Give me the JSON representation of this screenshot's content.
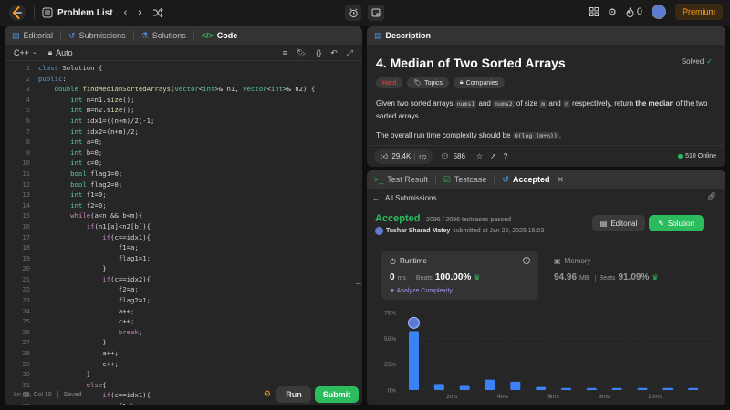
{
  "topbar": {
    "title": "Problem List",
    "premium": "Premium",
    "fire_count": "0"
  },
  "editor": {
    "tabs": [
      "Editorial",
      "Submissions",
      "Solutions",
      "Code"
    ],
    "language": "C++",
    "mode": "Auto",
    "status": "Ln 69, Col 10",
    "saved": "Saved",
    "run": "Run",
    "submit": "Submit"
  },
  "code_lines": [
    "class Solution {",
    "public:",
    "    double findMedianSortedArrays(vector<int>& n1, vector<int>& n2) {",
    "        int n=n1.size();",
    "        int m=n2.size();",
    "        int idx1=((n+m)/2)-1;",
    "        int idx2=(n+m)/2;",
    "        int a=0;",
    "        int b=0;",
    "        int c=0;",
    "        bool flag1=0;",
    "        bool flag2=0;",
    "        int f1=0;",
    "        int f2=0;",
    "        while(a<n && b<m){",
    "            if(n1[a]<n2[b]){",
    "                if(c==idx1){",
    "                    f1=a;",
    "                    flag1=1;",
    "                }",
    "                if(c==idx2){",
    "                    f2=a;",
    "                    flag2=1;",
    "                    a++;",
    "                    c++;",
    "                    break;",
    "                }",
    "                a++;",
    "                c++;",
    "            }",
    "            else{",
    "                if(c==idx1){",
    "                    f1=b;",
    "                }"
  ],
  "description": {
    "tab": "Description",
    "title": "4. Median of Two Sorted Arrays",
    "solved": "Solved",
    "chips": [
      "Hard",
      "Topics",
      "Companies"
    ],
    "para1_a": "Given two sorted arrays ",
    "code_nums1": "nums1",
    "para1_b": " and ",
    "code_nums2": "nums2",
    "para1_c": " of size ",
    "code_m": "m",
    "para1_d": " and ",
    "code_n": "n",
    "para1_e": " respectively, return ",
    "para1_bold": "the median",
    "para1_f": " of the two sorted arrays.",
    "para2": "The overall run time complexity should be ",
    "code_complexity": "O(log (m+n))",
    "para2_end": ".",
    "likes": "29.4K",
    "comments": "586",
    "online": "510 Online"
  },
  "result": {
    "tabs": [
      "Test Result",
      "Testcase",
      "Accepted"
    ],
    "back": "All Submissions",
    "status": "Accepted",
    "passed": "2096 / 2096 testcases passed",
    "user": "Tushar Sharad Matey",
    "submitted": "submitted at Jan 22, 2025 15:03",
    "editorial": "Editorial",
    "solution": "Solution",
    "runtime_label": "Runtime",
    "runtime_value": "0",
    "runtime_unit": "ms",
    "runtime_beats_label": "Beats",
    "runtime_beats": "100.00%",
    "analyze": "Analyze Complexity",
    "memory_label": "Memory",
    "memory_value": "94.96",
    "memory_unit": "MB",
    "memory_beats_label": "Beats",
    "memory_beats": "91.09%"
  },
  "chart_data": {
    "type": "bar",
    "y_ticks": [
      "75%",
      "50%",
      "25%",
      "0%"
    ],
    "ylim": [
      0,
      75
    ],
    "x_labels": [
      "2ms",
      "4ms",
      "6ms",
      "8ms",
      "10ms"
    ],
    "values": [
      57,
      5,
      4,
      10,
      8,
      3,
      2,
      2,
      2,
      2,
      2,
      2
    ]
  },
  "colors": {
    "accent_green": "#2cbb5d",
    "hard_red": "#ef4743",
    "premium_orange": "#ffa116",
    "bar_blue": "#3b82f6"
  }
}
